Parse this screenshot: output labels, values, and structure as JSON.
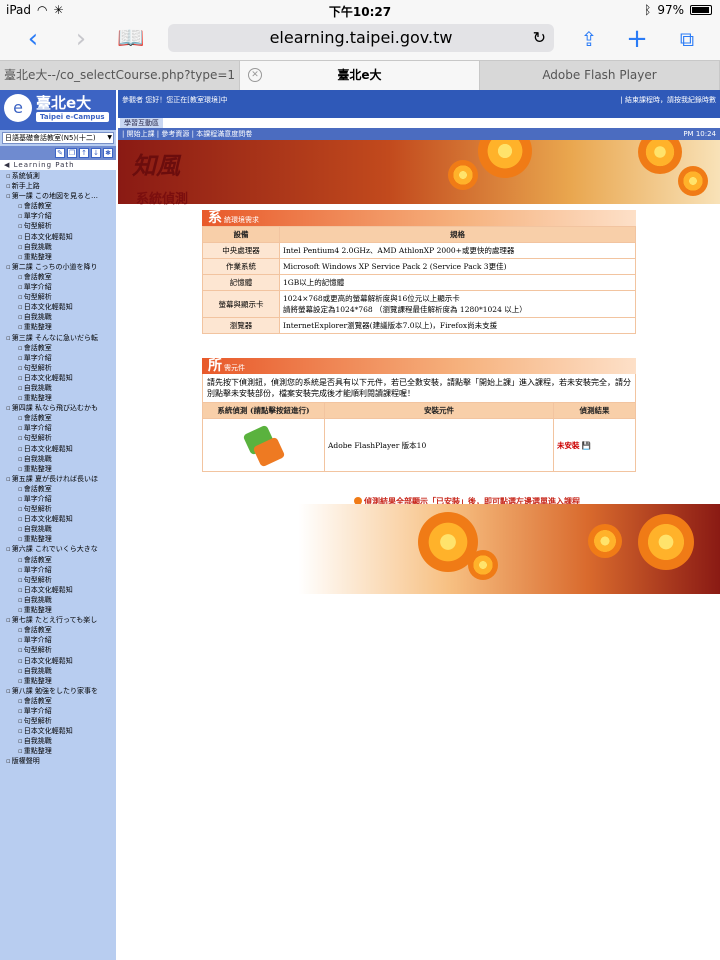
{
  "status": {
    "device": "iPad",
    "time": "下午10:27",
    "battery": "97%"
  },
  "browser": {
    "url": "elearning.taipei.gov.tw",
    "tabs": [
      {
        "label": "臺北e大--/co_selectCourse.php?type=1"
      },
      {
        "label": "臺北e大"
      },
      {
        "label": "Adobe Flash Player"
      }
    ]
  },
  "sidebar": {
    "logo_title": "臺北e大",
    "logo_sub": "Taipei e-Campus",
    "course_select": "日語基礎會話教室(N5)(十二)",
    "learning_path": "Learning Path",
    "tree": [
      {
        "label": "系統偵測",
        "sub": false
      },
      {
        "label": "新手上路",
        "sub": false
      },
      {
        "label": "第一課 この地図を見ると…",
        "sub": false
      },
      {
        "label": "會話教室",
        "sub": true
      },
      {
        "label": "單字介紹",
        "sub": true
      },
      {
        "label": "句型解析",
        "sub": true
      },
      {
        "label": "日本文化輕鬆知",
        "sub": true
      },
      {
        "label": "自我挑戰",
        "sub": true
      },
      {
        "label": "重點整理",
        "sub": true
      },
      {
        "label": "第二課 こっちの小道を降り",
        "sub": false
      },
      {
        "label": "會話教室",
        "sub": true
      },
      {
        "label": "單字介紹",
        "sub": true
      },
      {
        "label": "句型解析",
        "sub": true
      },
      {
        "label": "日本文化輕鬆知",
        "sub": true
      },
      {
        "label": "自我挑戰",
        "sub": true
      },
      {
        "label": "重點整理",
        "sub": true
      },
      {
        "label": "第三課 そんなに急いだら転",
        "sub": false
      },
      {
        "label": "會話教室",
        "sub": true
      },
      {
        "label": "單字介紹",
        "sub": true
      },
      {
        "label": "句型解析",
        "sub": true
      },
      {
        "label": "日本文化輕鬆知",
        "sub": true
      },
      {
        "label": "自我挑戰",
        "sub": true
      },
      {
        "label": "重點整理",
        "sub": true
      },
      {
        "label": "第四課 私なら飛び込むかも",
        "sub": false
      },
      {
        "label": "會話教室",
        "sub": true
      },
      {
        "label": "單字介紹",
        "sub": true
      },
      {
        "label": "句型解析",
        "sub": true
      },
      {
        "label": "日本文化輕鬆知",
        "sub": true
      },
      {
        "label": "自我挑戰",
        "sub": true
      },
      {
        "label": "重點整理",
        "sub": true
      },
      {
        "label": "第五課 夏が長ければ長いほ",
        "sub": false
      },
      {
        "label": "會話教室",
        "sub": true
      },
      {
        "label": "單字介紹",
        "sub": true
      },
      {
        "label": "句型解析",
        "sub": true
      },
      {
        "label": "日本文化輕鬆知",
        "sub": true
      },
      {
        "label": "自我挑戰",
        "sub": true
      },
      {
        "label": "重點整理",
        "sub": true
      },
      {
        "label": "第六課 これでいくら大きな",
        "sub": false
      },
      {
        "label": "會話教室",
        "sub": true
      },
      {
        "label": "單字介紹",
        "sub": true
      },
      {
        "label": "句型解析",
        "sub": true
      },
      {
        "label": "日本文化輕鬆知",
        "sub": true
      },
      {
        "label": "自我挑戰",
        "sub": true
      },
      {
        "label": "重點整理",
        "sub": true
      },
      {
        "label": "第七課 たとえ行っても楽し",
        "sub": false
      },
      {
        "label": "會話教室",
        "sub": true
      },
      {
        "label": "單字介紹",
        "sub": true
      },
      {
        "label": "句型解析",
        "sub": true
      },
      {
        "label": "日本文化輕鬆知",
        "sub": true
      },
      {
        "label": "自我挑戰",
        "sub": true
      },
      {
        "label": "重點整理",
        "sub": true
      },
      {
        "label": "第八課 勉強をしたり家事を",
        "sub": false
      },
      {
        "label": "會話教室",
        "sub": true
      },
      {
        "label": "單字介紹",
        "sub": true
      },
      {
        "label": "句型解析",
        "sub": true
      },
      {
        "label": "日本文化輕鬆知",
        "sub": true
      },
      {
        "label": "自我挑戰",
        "sub": true
      },
      {
        "label": "重點整理",
        "sub": true
      },
      {
        "label": "版權聲明",
        "sub": false
      }
    ]
  },
  "main": {
    "welcome": "參觀者 您好！您正在[教室環境]中",
    "actions": "| 結束課程時，請按我紀錄時數",
    "tab_label": "學習互動區",
    "nav": "| 開始上課 | 參考資源 | 本課程滿意度問卷",
    "pm": "PM 10:24",
    "banner_text": "知風",
    "page_title": "系統偵測",
    "env": {
      "head_big": "系",
      "head_small": "統環境需求",
      "col1": "設備",
      "col2": "規格",
      "rows": [
        {
          "label": "中央處理器",
          "value": "Intel Pentium4 2.0GHz、AMD AthlonXP 2000+或更快的處理器"
        },
        {
          "label": "作業系統",
          "value": "Microsoft Windows XP Service Pack 2 (Service Pack 3更佳)"
        },
        {
          "label": "記憶體",
          "value": "1GB以上的記憶體"
        },
        {
          "label": "螢幕與顯示卡",
          "value": "1024×768或更高的螢幕解析度與16位元以上顯示卡",
          "value2": "請將螢幕設定為1024*768 （瀏覽課程最佳解析度為 1280*1024 以上）"
        },
        {
          "label": "瀏覽器",
          "value": "InternetExplorer瀏覽器(建議版本7.0以上)，Firefox尚未支援"
        }
      ]
    },
    "comp": {
      "head_big": "所",
      "head_small": "需元件",
      "desc": "請先按下偵測鈕，偵測您的系統是否具有以下元件，若已全數安裝，請點擊「開始上課」進入課程，若未安裝完全，請分別點擊未安裝部份，檔案安裝完成後才能順利閱讀課程喔！",
      "col1": "系統偵測 (請點擊按鈕進行)",
      "col2": "安裝元件",
      "col3": "偵測結果",
      "component": "Adobe FlashPlayer 版本10",
      "result": "未安裝"
    },
    "note": "偵測結果全部顯示「已安裝」後，即可點選左邊選單進入課程"
  }
}
